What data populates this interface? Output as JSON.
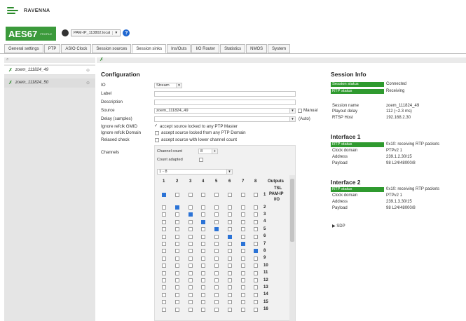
{
  "header": {
    "brand": "RAVENNA",
    "product": "AES67",
    "product_sub": "PROFILE",
    "host": "PAM-IP_113802.local"
  },
  "tabs": [
    "General settings",
    "PTP",
    "ASIO Clock",
    "Session sources",
    "Session sinks",
    "Ins/Outs",
    "I/O Router",
    "Statistics",
    "NMOS",
    "System"
  ],
  "active_tab": "Session sinks",
  "sidebar": {
    "items": [
      {
        "name": "zoem_111824_49",
        "selected": false
      },
      {
        "name": "zoem_111824_50",
        "selected": true
      }
    ]
  },
  "config": {
    "title": "Configuration",
    "io_label": "IO",
    "io_value": "Stream",
    "label_label": "Label",
    "description_label": "Description",
    "source_label": "Source",
    "source_value": "zoem_111824_49",
    "manual_label": "Manual",
    "delay_label": "Delay (samples)",
    "delay_auto": "(Auto)",
    "ignore_gmid_label": "Ignore refclk GMID",
    "ignore_gmid_text": "accept source locked to any PTP Master",
    "ignore_gmid_checked": true,
    "ignore_domain_label": "Ignore refclk Domain",
    "ignore_domain_text": "accept source locked from any PTP Domain",
    "ignore_domain_checked": false,
    "relaxed_label": "Relaxed check",
    "relaxed_text": "accept source with lower channel count",
    "relaxed_checked": false,
    "channels_label": "Channels"
  },
  "matrix": {
    "channel_count_label": "Channel count",
    "channel_count_value": "8",
    "count_adapted_label": "Count adapted",
    "range_value": "1 - 8",
    "columns": [
      "1",
      "2",
      "3",
      "4",
      "5",
      "6",
      "7",
      "8"
    ],
    "outputs_label": "Outputs",
    "first_output_lines": [
      "TSL",
      "PAM-IP",
      "I/O"
    ],
    "rows": [
      "1",
      "2",
      "3",
      "4",
      "5",
      "6",
      "7",
      "8",
      "9",
      "10",
      "11",
      "12",
      "13",
      "14",
      "15",
      "16"
    ],
    "checked": [
      [
        0,
        0
      ],
      [
        1,
        1
      ],
      [
        2,
        2
      ],
      [
        3,
        3
      ],
      [
        4,
        4
      ],
      [
        5,
        5
      ],
      [
        6,
        6
      ],
      [
        7,
        7
      ]
    ]
  },
  "session_info": {
    "title": "Session Info",
    "status_rows": [
      {
        "label": "Session status",
        "value": "Connected"
      },
      {
        "label": "RTP status",
        "value": "Receiving"
      }
    ],
    "rows": [
      {
        "label": "Session name",
        "value": "zoem_111824_49"
      },
      {
        "label": "Playout delay",
        "value": "112 (~2.3 ms)"
      },
      {
        "label": "RTSP Host",
        "value": "192.168.2.30"
      }
    ],
    "interface1": {
      "title": "Interface 1",
      "rtp_label": "RTP status",
      "rtp_value": "0x10: receiving RTP packets",
      "clock_label": "Clock domain",
      "clock_value": "PTPv2 1",
      "address_label": "Address",
      "address_value": "239.1.2.30/15",
      "payload_label": "Payload",
      "payload_value": "98 L24/48000/8"
    },
    "interface2": {
      "title": "Interface 2",
      "rtp_label": "RTP status",
      "rtp_value": "0x10: receiving RTP packets",
      "clock_label": "Clock domain",
      "clock_value": "PTPv2 1",
      "address_label": "Address",
      "address_value": "239.1.3.30/15",
      "payload_label": "Payload",
      "payload_value": "98 L24/48000/8"
    },
    "sdp_label": "SDP"
  },
  "colors": {
    "accent_green": "#2f9a2f",
    "checkbox_blue": "#2b73d6"
  }
}
